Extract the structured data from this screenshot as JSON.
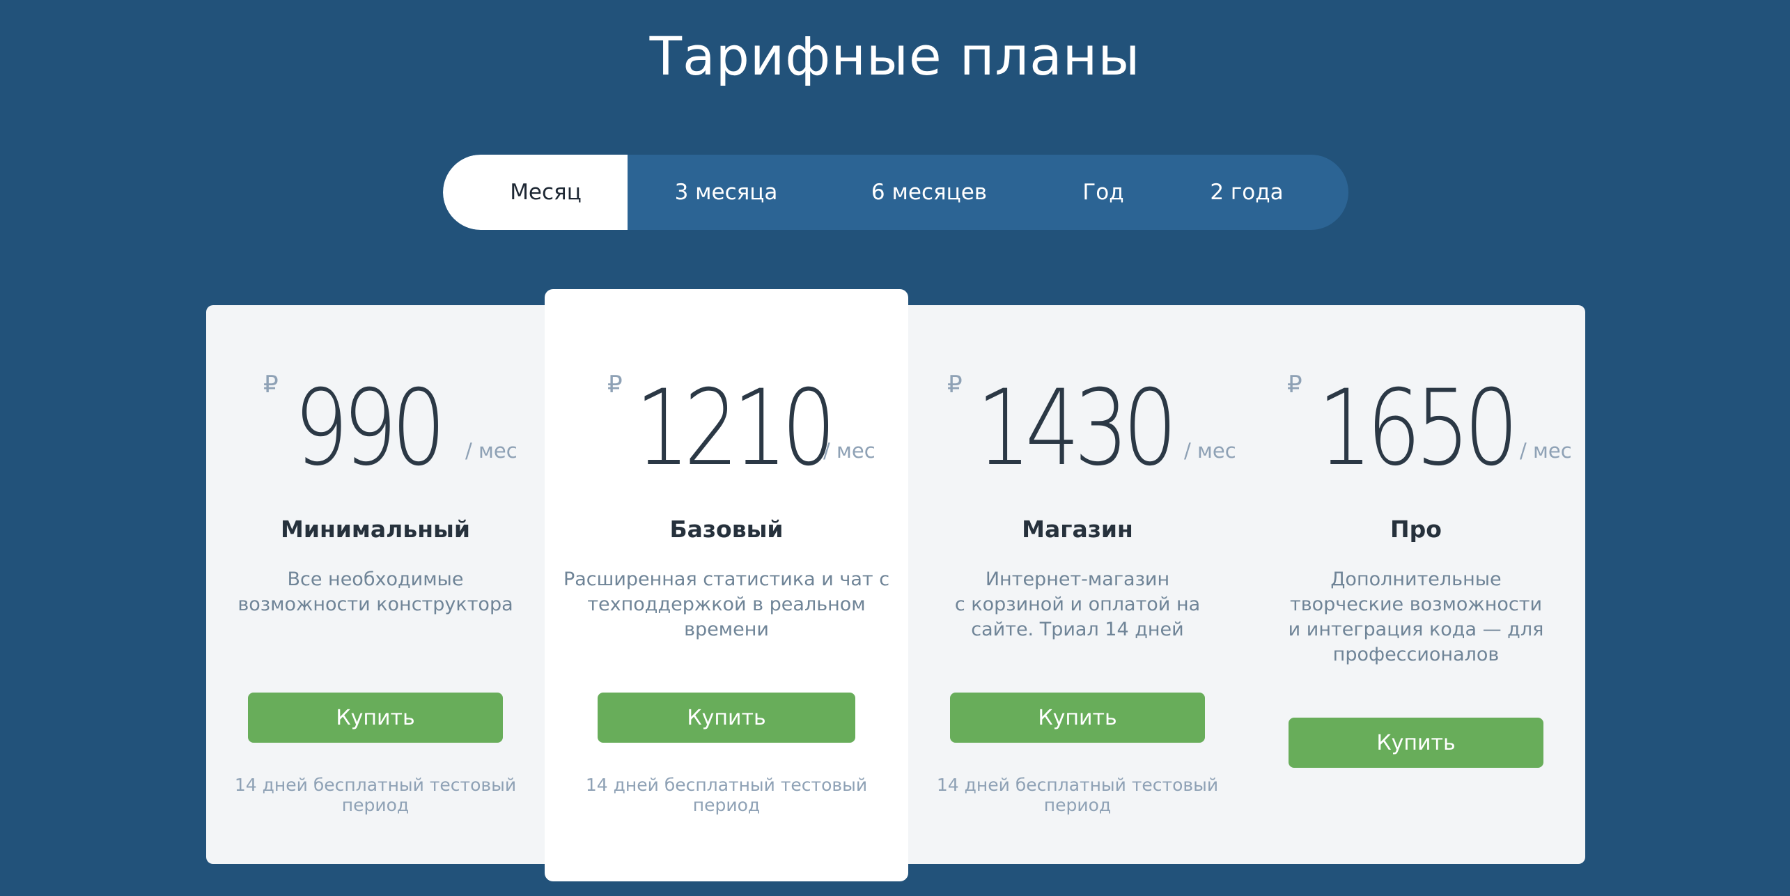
{
  "page": {
    "title": "Тарифные планы"
  },
  "period_tabs": [
    {
      "label": "Месяц",
      "active": true
    },
    {
      "label": "3 месяца",
      "active": false
    },
    {
      "label": "6 месяцев",
      "active": false
    },
    {
      "label": "Год",
      "active": false
    },
    {
      "label": "2 года",
      "active": false
    }
  ],
  "plans": [
    {
      "currency": "₽",
      "price": "990",
      "per": "/ мес",
      "name": "Минимальный",
      "description": "Все необходимые\nвозможности конструктора",
      "button_label": "Купить",
      "trial": "14 дней бесплатный тестовый\nпериод"
    },
    {
      "currency": "₽",
      "price": "1210",
      "per": "/ мес",
      "name": "Базовый",
      "description": "Расширенная статистика и чат с\nтехподдержкой в реальном\nвремени",
      "button_label": "Купить",
      "trial": "14 дней бесплатный тестовый\nпериод"
    },
    {
      "currency": "₽",
      "price": "1430",
      "per": "/ мес",
      "name": "Магазин",
      "description": "Интернет-магазин\nс корзиной и оплатой на\nсайте. Триал 14 дней",
      "button_label": "Купить",
      "trial": "14 дней бесплатный тестовый\nпериод"
    },
    {
      "currency": "₽",
      "price": "1650",
      "per": "/ мес",
      "name": "Про",
      "description": "Дополнительные\nтворческие возможности\nи интеграция кода — для\nпрофессионалов",
      "button_label": "Купить"
    }
  ],
  "colors": {
    "background": "#22527a",
    "tabs_bg": "#2c6494",
    "card_bg": "#f3f5f7",
    "featured_card_bg": "#ffffff",
    "buy_button": "#68ad5a",
    "muted_text": "#8ea1b5"
  }
}
